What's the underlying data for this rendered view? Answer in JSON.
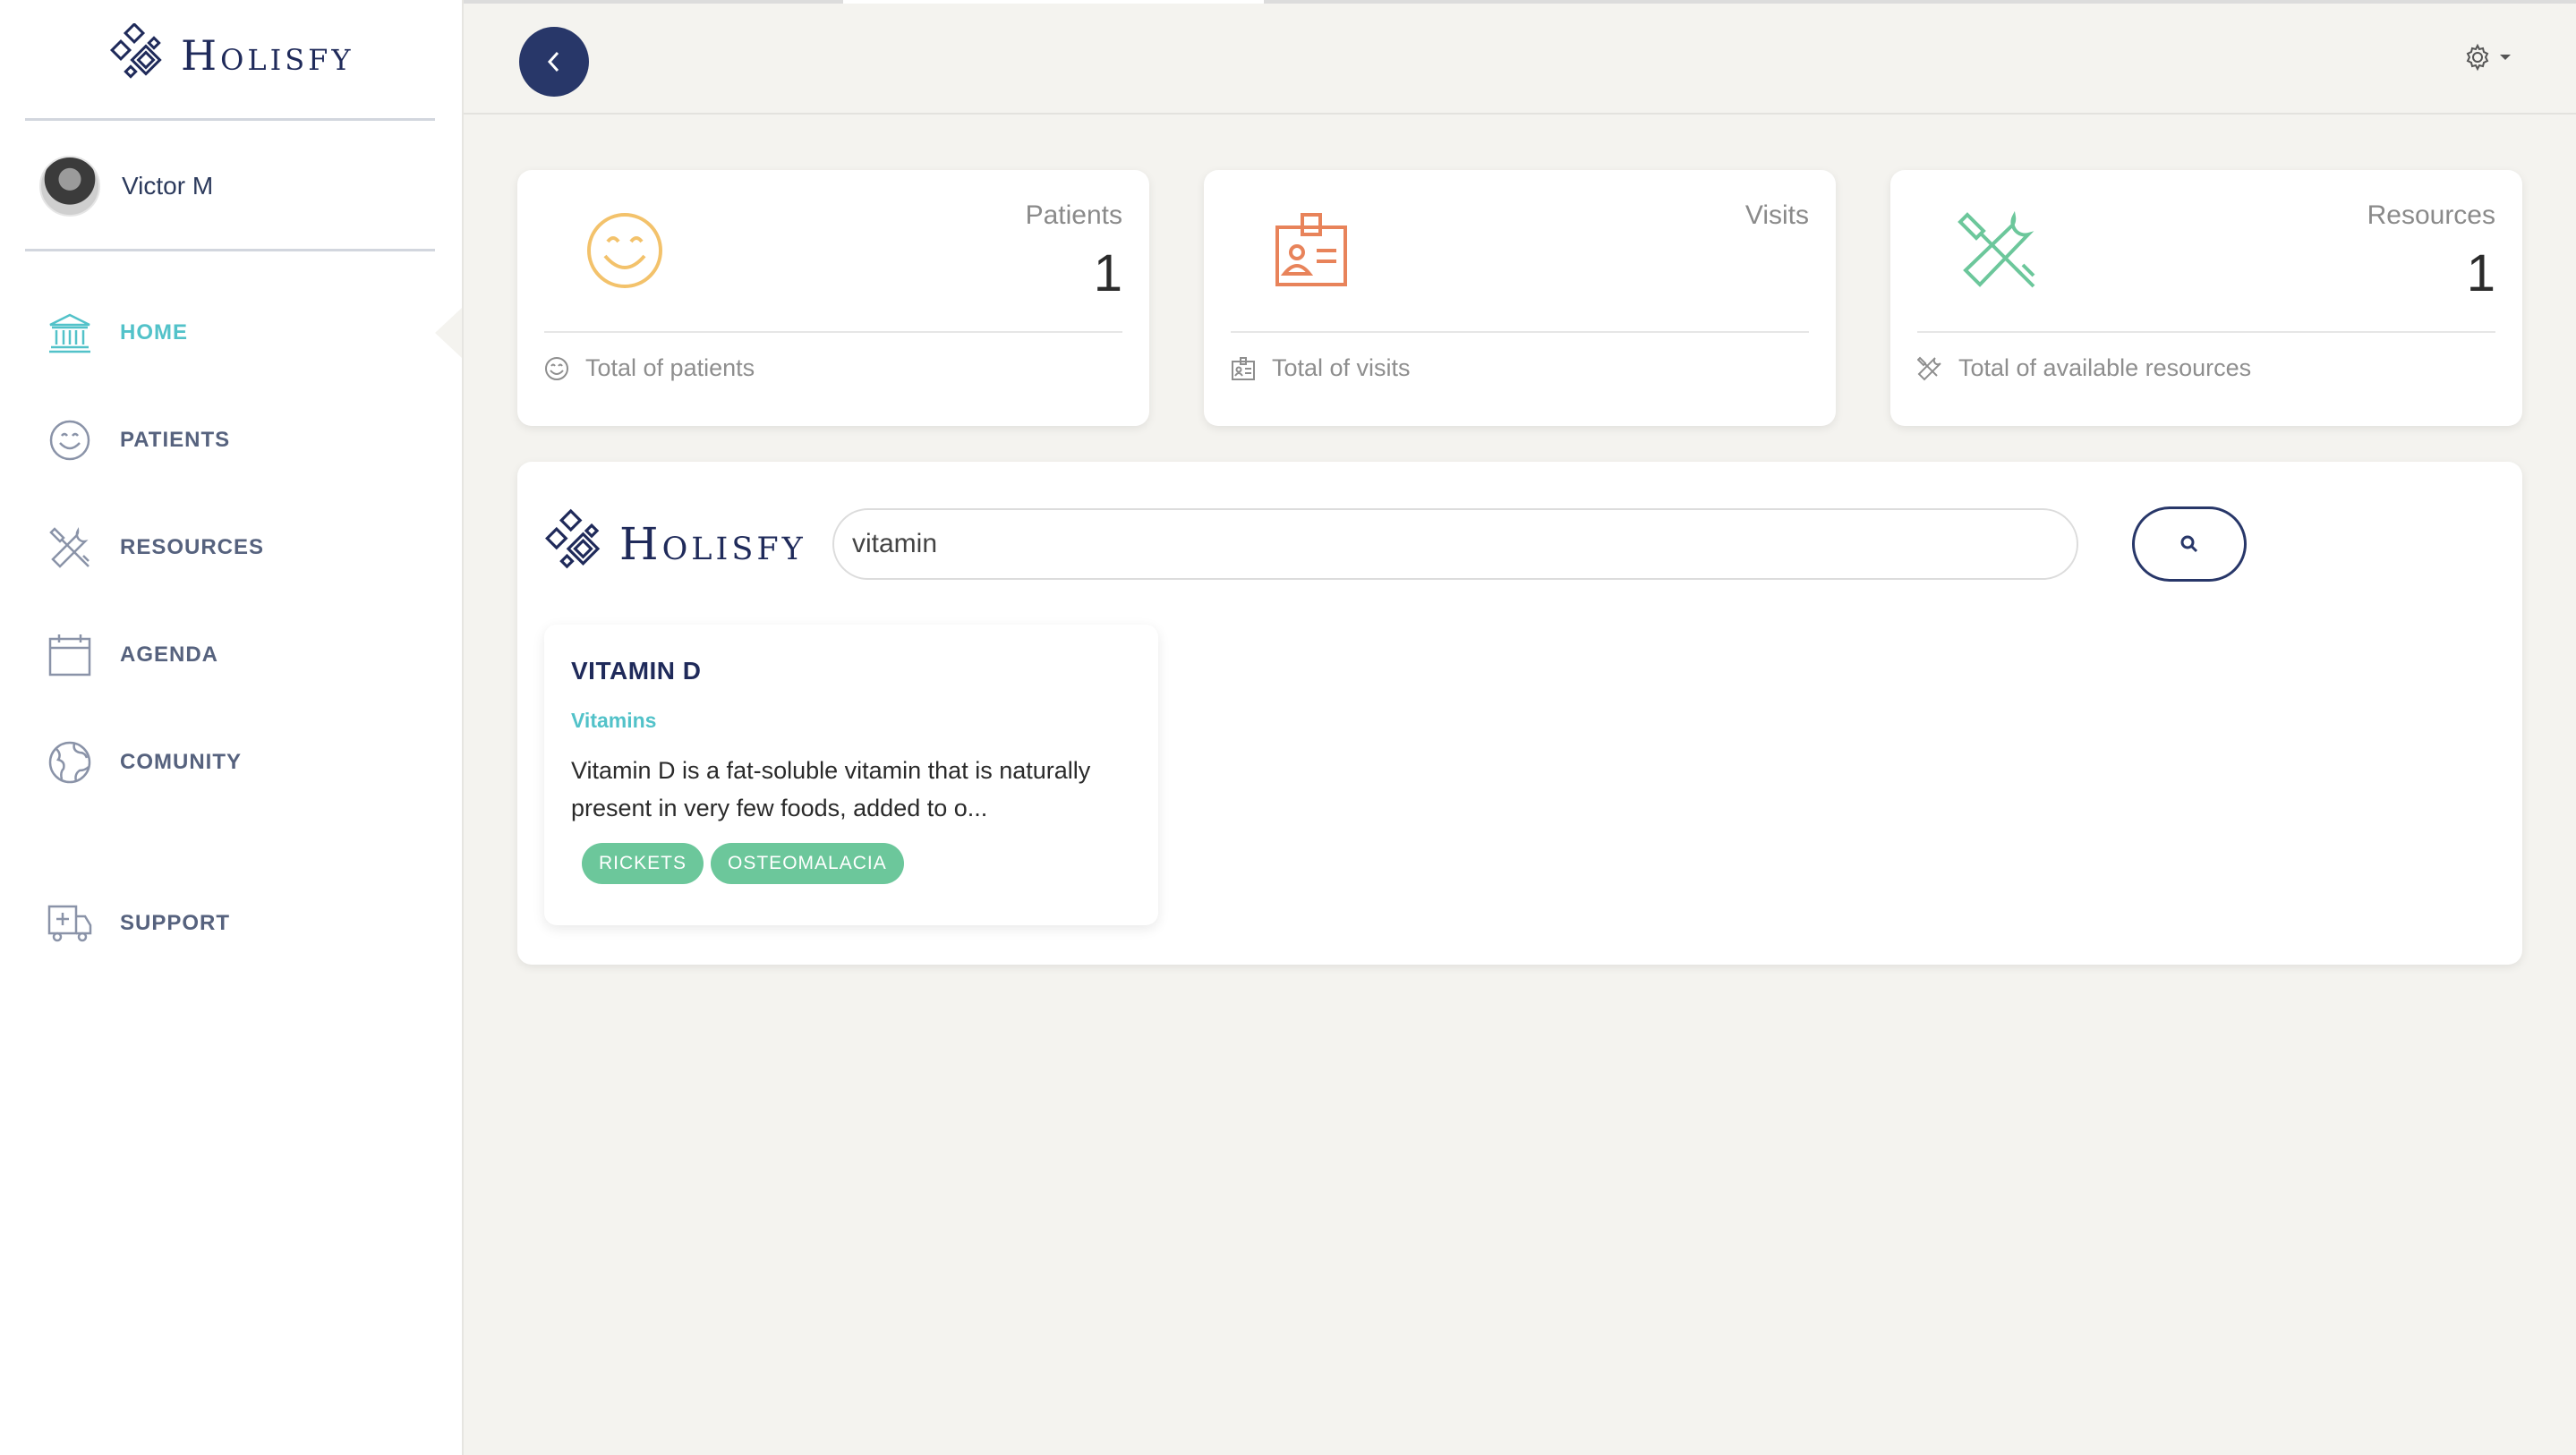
{
  "brand": {
    "name": "Holisfy"
  },
  "user": {
    "name": "Victor M"
  },
  "nav": {
    "items": [
      {
        "label": "HOME",
        "icon": "bank-icon",
        "active": true
      },
      {
        "label": "PATIENTS",
        "icon": "smile-icon",
        "active": false
      },
      {
        "label": "RESOURCES",
        "icon": "tools-icon",
        "active": false
      },
      {
        "label": "AGENDA",
        "icon": "calendar-icon",
        "active": false
      },
      {
        "label": "COMUNITY",
        "icon": "globe-icon",
        "active": false
      },
      {
        "label": "SUPPORT",
        "icon": "ambulance-icon",
        "active": false
      }
    ]
  },
  "header": {
    "back_icon": "chevron-left-icon",
    "settings_icon": "gear-icon"
  },
  "stats": [
    {
      "title": "Patients",
      "value": "1",
      "footer": "Total of patients",
      "icon": "smile-icon",
      "color": "#f3c26b"
    },
    {
      "title": "Visits",
      "value": "",
      "footer": "Total of visits",
      "icon": "id-badge-icon",
      "color": "#e8835a"
    },
    {
      "title": "Resources",
      "value": "1",
      "footer": "Total of available resources",
      "icon": "tools-icon",
      "color": "#6cc79b"
    }
  ],
  "search": {
    "query": "vitamin",
    "button_icon": "search-icon"
  },
  "results": [
    {
      "title": "VITAMIN D",
      "category": "Vitamins",
      "description": "Vitamin D is a fat-soluble vitamin that is naturally present in very few foods, added to o...",
      "tags": [
        "RICKETS",
        "OSTEOMALACIA"
      ]
    }
  ],
  "colors": {
    "primary": "#283769",
    "accent": "#52c2c9",
    "tag": "#6cc79b",
    "patients": "#f3c26b",
    "visits": "#e8835a",
    "resources": "#6cc79b"
  }
}
